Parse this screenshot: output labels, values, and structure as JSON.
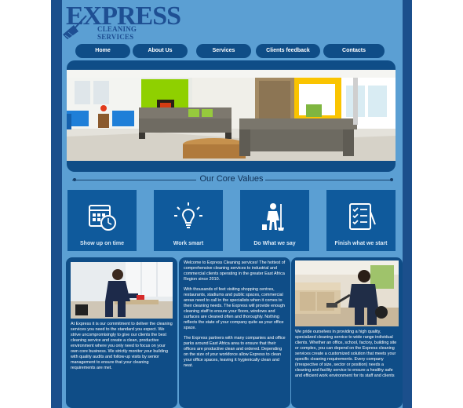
{
  "logo": {
    "brand": "EXPRESS",
    "tagline": "CLEANING SERVICES"
  },
  "nav": {
    "items": [
      "Home",
      "About Us",
      "Services",
      "Clients feedback",
      "Contacts"
    ]
  },
  "core_values": {
    "title": "Our Core Values",
    "tiles": [
      {
        "label": "Show up on time",
        "icon": "calendar-clock-icon"
      },
      {
        "label": "Work smart",
        "icon": "lightbulb-icon"
      },
      {
        "label": "Do What we say",
        "icon": "cleaner-icon"
      },
      {
        "label": "Finish what we start",
        "icon": "checklist-icon"
      }
    ]
  },
  "cards": {
    "left": "At Express it is our commitment to deliver the cleaning services you need to the standard you expect. We strive uncompromisingly to give our clients the best cleaning service and create a clean, productive environment where you only need to focus on your own core business. We strictly monitor your building with quality audits and follow-up visits by senior management to ensure that your cleaning requirements are met.",
    "middle": [
      "Welcome to Express Cleaning services! The hottest of comprehensive cleaning services to industrial and commercial clients operating in the greater East Africa Region since 2010.",
      "With thousands of feet visiting shopping centres, restaurants, stadiums and public spaces, commercial areas need to call in the specialists when it comes to their cleaning needs. The Express will provide enough cleaning staff to ensure your floors, windows and surfaces are cleaned often and thoroughly. Nothing reflects the state of your company quite as your office space.",
      "The Express partners with many companies and office parks around East Africa area to ensure that their offices are productive clean and ordered. Depending on the size of your workforce allow Express to clean your office spaces, leaving it hygienically clean and neat."
    ],
    "right": "We pride ourselves in providing a high quality, specialized cleaning service to wide range individual clients. Whether an office, school, factory, building site or complex, you can depend on the Express cleaning services create a customized solution that meets your specific cleaning requirements. Every company (irrespective of size, sector or position) needs a cleaning and facility service to ensure a healthy safe and efficient work environment for its staff and clients"
  },
  "colors": {
    "page_blue": "#5b9fd3",
    "dark_blue": "#0f4d87",
    "tile_blue": "#0f5a9c",
    "logo_blue": "#1e4f93"
  }
}
